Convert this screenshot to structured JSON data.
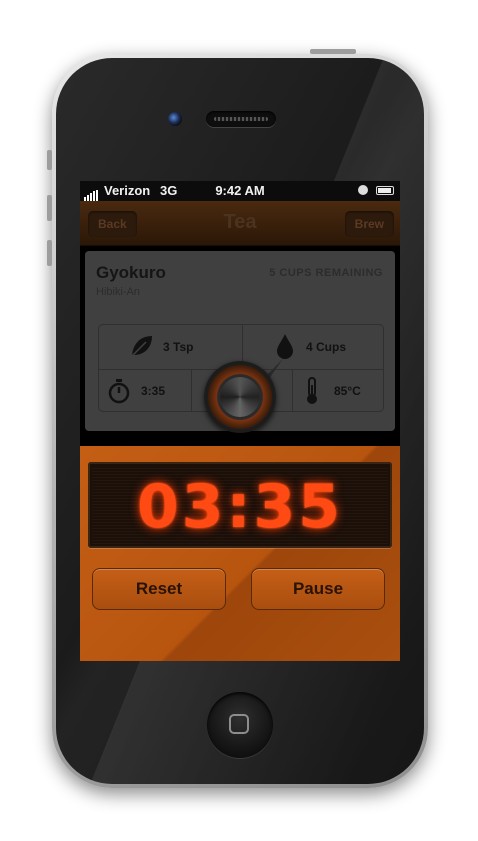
{
  "status_bar": {
    "carrier": "Verizon",
    "network": "3G",
    "time": "9:42 AM"
  },
  "nav": {
    "back_label": "Back",
    "title": "Tea",
    "brew_label": "Brew"
  },
  "tea": {
    "name": "Gyokuro",
    "shop": "Hibiki-An",
    "cups_remaining": "5 CUPS REMAINING",
    "amount": "3 Tsp",
    "water": "4 Cups",
    "steep_time": "3:35",
    "temperature": "85°C"
  },
  "timer": {
    "display": "03:35",
    "reset_label": "Reset",
    "pause_label": "Pause"
  },
  "colors": {
    "accent": "#c45e15",
    "digits": "#ff4a14"
  },
  "icons": [
    "leaf-icon",
    "water-drop-icon",
    "stopwatch-icon",
    "thermometer-icon",
    "home-button-icon"
  ]
}
